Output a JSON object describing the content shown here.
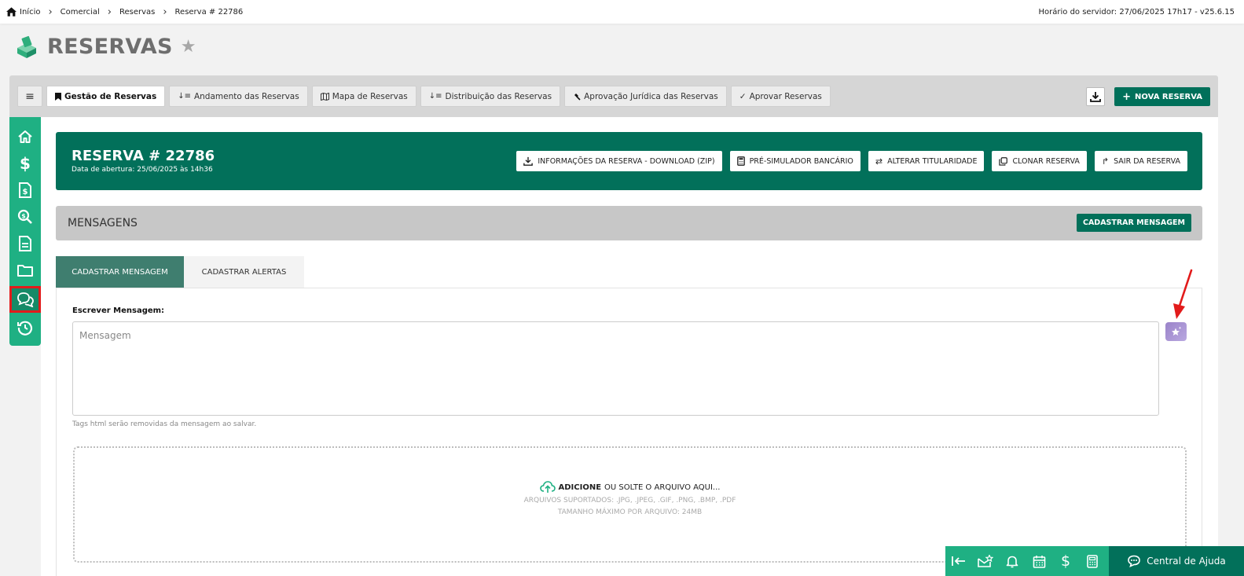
{
  "breadcrumb": [
    "Início",
    "Comercial",
    "Reservas",
    "Reserva # 22786"
  ],
  "server_time": "Horário do servidor: 27/06/2025 17h17 - v25.6.15",
  "page_title": "RESERVAS",
  "tabs": [
    {
      "label": "Gestão de Reservas",
      "icon": "bookmark-icon",
      "active": true
    },
    {
      "label": "Andamento das Reservas",
      "icon": "sort-down-icon"
    },
    {
      "label": "Mapa de Reservas",
      "icon": "map-icon"
    },
    {
      "label": "Distribuição das Reservas",
      "icon": "sort-down-icon"
    },
    {
      "label": "Aprovação Jurídica das Reservas",
      "icon": "gavel-icon"
    },
    {
      "label": "Aprovar Reservas",
      "icon": "check-icon"
    }
  ],
  "nova_reserva": "NOVA RESERVA",
  "reserva": {
    "title": "RESERVA # 22786",
    "subtitle": "Data de abertura: 25/06/2025 às 14h36",
    "actions": [
      "INFORMAÇÕES DA RESERVA - DOWNLOAD (ZIP)",
      "PRÉ-SIMULADOR BANCÁRIO",
      "ALTERAR TITULARIDADE",
      "CLONAR RESERVA",
      "SAIR DA RESERVA"
    ]
  },
  "mensagens": {
    "header": "MENSAGENS",
    "cadastrar_btn": "CADASTRAR MENSAGEM",
    "tabs": [
      "CADASTRAR MENSAGEM",
      "CADASTRAR ALERTAS"
    ],
    "field_label": "Escrever Mensagem:",
    "placeholder": "Mensagem",
    "hint": "Tags html serão removidas da mensagem ao salvar.",
    "dropzone": {
      "action": "ADICIONE",
      "action_rest": "OU SOLTE O ARQUIVO AQUI...",
      "supported": "ARQUIVOS SUPORTADOS: .JPG, .JPEG, .GIF, .PNG, .BMP, .PDF",
      "max_size": "TAMANHO MÁXIMO POR ARQUIVO: 24MB"
    }
  },
  "help": "Central de Ajuda",
  "colors": {
    "brand_dark": "#02705a",
    "brand_light": "#1fb083",
    "annotation": "#e21b1b"
  }
}
